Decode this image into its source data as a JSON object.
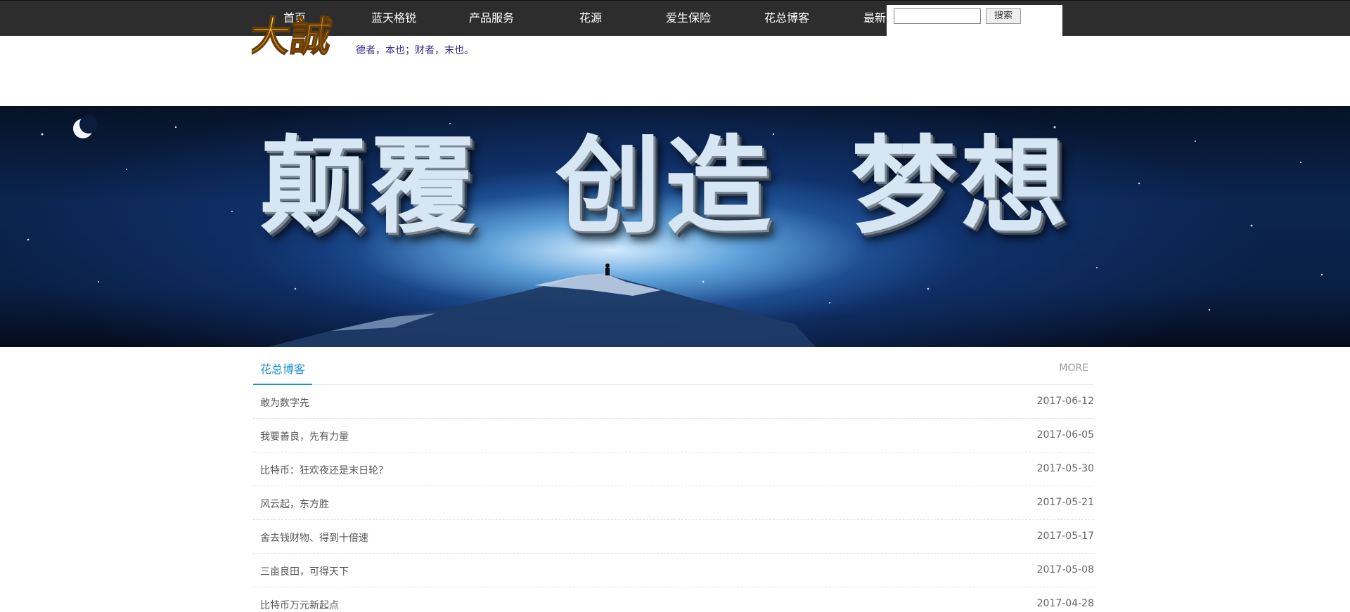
{
  "nav": {
    "items": [
      {
        "label": "首页"
      },
      {
        "label": "蓝天格锐"
      },
      {
        "label": "产品服务"
      },
      {
        "label": "花源"
      },
      {
        "label": "爱生保险"
      },
      {
        "label": "花总博客"
      },
      {
        "label": "最新"
      }
    ]
  },
  "search": {
    "value": "",
    "button_label": "搜索"
  },
  "logo": {
    "text": "大誠",
    "slogan": "德者，本也；财者，末也。"
  },
  "banner": {
    "words": [
      "颠覆",
      "创造",
      "梦想"
    ]
  },
  "blog": {
    "tab_label": "花总博客",
    "more_label": "MORE",
    "posts": [
      {
        "title": "敢为数字先",
        "date": "2017-06-12"
      },
      {
        "title": "我要善良，先有力量",
        "date": "2017-06-05"
      },
      {
        "title": "比特币：狂欢夜还是末日轮？",
        "date": "2017-05-30"
      },
      {
        "title": "风云起，东方胜",
        "date": "2017-05-21"
      },
      {
        "title": "舍去钱财物、得到十倍速",
        "date": "2017-05-17"
      },
      {
        "title": "三亩良田，可得天下",
        "date": "2017-05-08"
      },
      {
        "title": "比特币万元新起点",
        "date": "2017-04-28"
      }
    ]
  },
  "colors": {
    "nav_bg": "#2d2d2d",
    "accent": "#1a8fd2",
    "slogan": "#3a2a8a",
    "logo_gold": "#e0a020"
  }
}
